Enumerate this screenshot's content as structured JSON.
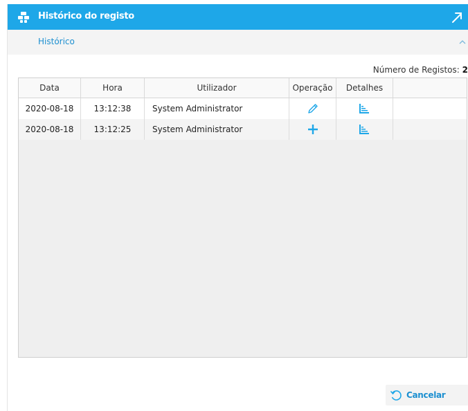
{
  "window": {
    "title": "Histórico do registo",
    "icon": "cubes-icon",
    "expand_icon": "expand-arrow-icon"
  },
  "section": {
    "label": "Histórico",
    "toggle_icon": "chevron-up-icon"
  },
  "records": {
    "count_label": "Número de Registos:",
    "count_value": "2"
  },
  "table": {
    "columns": [
      "Data",
      "Hora",
      "Utilizador",
      "Operação",
      "Detalhes",
      ""
    ],
    "rows": [
      {
        "date": "2020-08-18",
        "time": "13:12:38",
        "user": "System Administrator",
        "operation_icon": "edit-pencil-icon",
        "details_icon": "details-chart-icon"
      },
      {
        "date": "2020-08-18",
        "time": "13:12:25",
        "user": "System Administrator",
        "operation_icon": "add-plus-icon",
        "details_icon": "details-chart-icon"
      }
    ]
  },
  "footer": {
    "cancel_label": "Cancelar",
    "cancel_icon": "undo-icon"
  },
  "colors": {
    "accent": "#1ea7e8",
    "link": "#1c8fd0"
  }
}
